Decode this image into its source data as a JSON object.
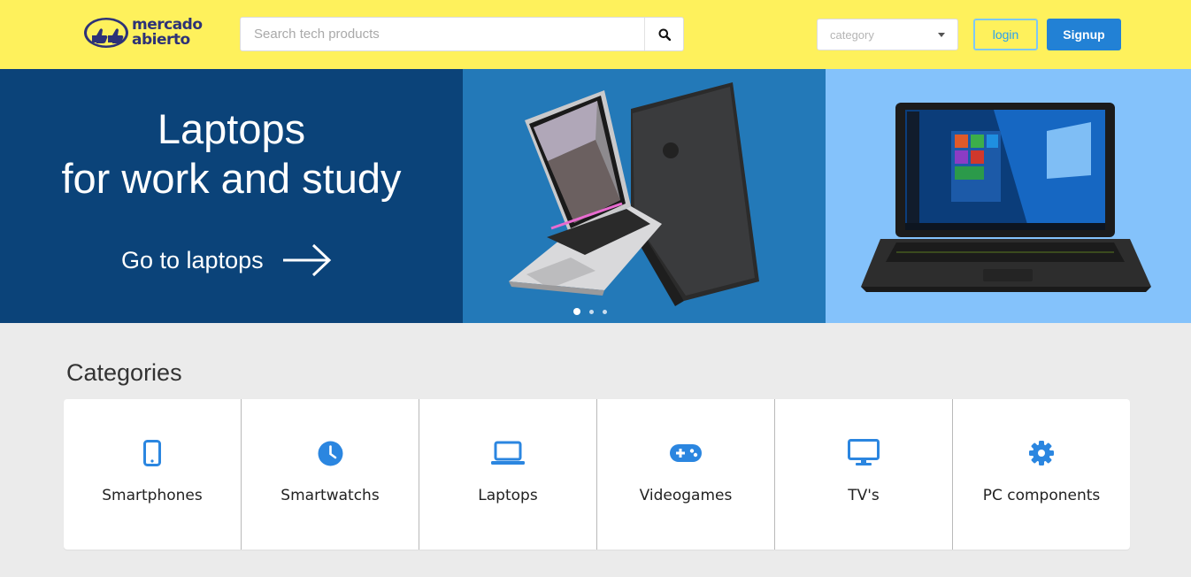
{
  "header": {
    "logo": {
      "line1": "mercado",
      "line2": "abierto"
    },
    "search": {
      "placeholder": "Search tech products",
      "icon": "search-icon"
    },
    "category": {
      "selected": "category"
    },
    "login_label": "login",
    "signup_label": "Signup"
  },
  "banner": {
    "title_line1": "Laptops",
    "title_line2": "for work and study",
    "cta_label": "Go to laptops",
    "slides": 3,
    "active_slide": 1
  },
  "categories": {
    "title": "Categories",
    "items": [
      {
        "label": "Smartphones",
        "icon": "smartphone-icon"
      },
      {
        "label": "Smartwatchs",
        "icon": "clock-icon"
      },
      {
        "label": "Laptops",
        "icon": "laptop-icon"
      },
      {
        "label": "Videogames",
        "icon": "gamepad-icon"
      },
      {
        "label": "TV's",
        "icon": "monitor-icon"
      },
      {
        "label": "PC components",
        "icon": "gear-icon"
      }
    ]
  },
  "colors": {
    "header_bg": "#fef15c",
    "brand_navy": "#2d3277",
    "accent_blue": "#2281d5",
    "icon_blue": "#2b86e0",
    "banner_left": "#0b4379",
    "banner_mid": "#2379b8",
    "banner_right": "#84c2fb"
  }
}
